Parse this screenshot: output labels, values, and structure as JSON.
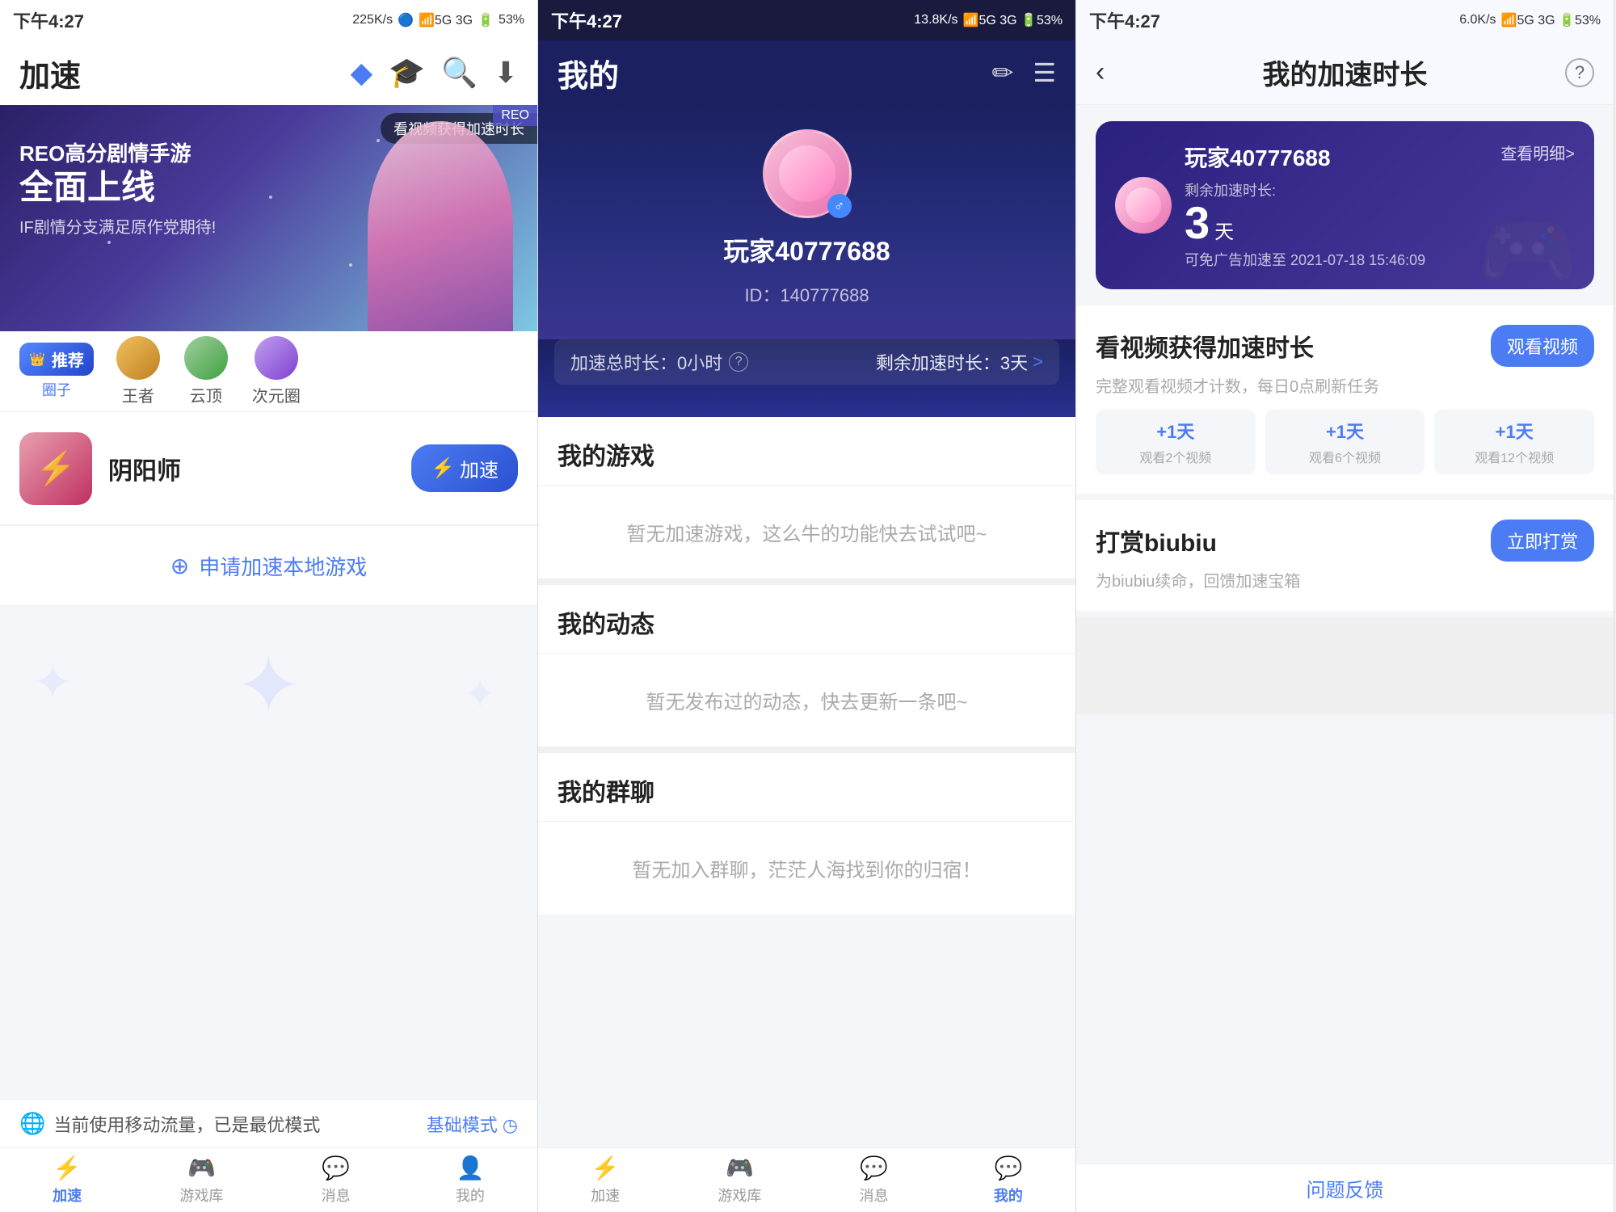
{
  "panel1": {
    "status": {
      "time": "下午4:27",
      "network_speed": "225K/s",
      "battery": "53%",
      "icons": "🔵 ♪ ◷ HD 📶 5G 3G 🔋"
    },
    "header": {
      "title": "加速",
      "icon_blue": "◆",
      "icon_hat": "🎓",
      "icon_search": "🔍",
      "icon_download": "⬇"
    },
    "banner": {
      "watch_badge": "看视频获得加速时长",
      "corner": "REO",
      "brand": "REO高分剧情手游",
      "main_title": "全面上线",
      "sub_title": "IF剧情分支满足原作党期待!"
    },
    "categories": [
      {
        "label": "推荐\n圈子",
        "type": "highlight"
      },
      {
        "label": "王者",
        "type": "normal"
      },
      {
        "label": "云顶",
        "type": "normal"
      },
      {
        "label": "次元圈",
        "type": "normal"
      }
    ],
    "game": {
      "name": "阴阳师",
      "speed_btn": "加速"
    },
    "apply_bar": "申请加速本地游戏",
    "data_mode": {
      "text": "当前使用移动流量，已是最优模式",
      "link": "基础模式 ◷"
    },
    "nav": [
      {
        "label": "加速",
        "active": true
      },
      {
        "label": "游戏库",
        "active": false
      },
      {
        "label": "消息",
        "active": false
      },
      {
        "label": "我的",
        "active": false
      }
    ]
  },
  "panel2": {
    "status": {
      "time": "下午4:27",
      "network_speed": "13.8K/s"
    },
    "header": {
      "title": "我的",
      "edit_icon": "✏",
      "menu_icon": "☰"
    },
    "profile": {
      "username": "玩家40777688",
      "id": "ID：140777688",
      "gender": "♂"
    },
    "speed_bar": {
      "total_label": "加速总时长：0小时",
      "tooltip": "?",
      "remain_label": "剩余加速时长：3天",
      "arrow": ">"
    },
    "my_games": {
      "title": "我的游戏",
      "empty": "暂无加速游戏，这么牛的功能快去试试吧~"
    },
    "my_moments": {
      "title": "我的动态",
      "empty": "暂无发布过的动态，快去更新一条吧~"
    },
    "my_groups": {
      "title": "我的群聊",
      "empty": "暂无加入群聊，茫茫人海找到你的归宿！"
    },
    "nav": [
      {
        "label": "加速",
        "active": false
      },
      {
        "label": "游戏库",
        "active": false
      },
      {
        "label": "消息",
        "active": false
      },
      {
        "label": "我的",
        "active": true
      }
    ]
  },
  "panel3": {
    "status": {
      "time": "下午4:27",
      "network_speed": "6.0K/s"
    },
    "header": {
      "back": "‹",
      "title": "我的加速时长",
      "help": "?"
    },
    "accel_card": {
      "username": "玩家40777688",
      "detail_link": "查看明细>",
      "remain_label": "剩余加速时长:",
      "days": "3",
      "unit": "天",
      "until": "可免广告加速至 2021-07-18 15:46:09"
    },
    "watch_video": {
      "title": "看视频获得加速时长",
      "subtitle": "完整观看视频才计数，每日0点刷新任务",
      "btn": "观看视频",
      "rewards": [
        {
          "plus": "+1天",
          "label": "观看2个视频"
        },
        {
          "plus": "+1天",
          "label": "观看6个视频"
        },
        {
          "plus": "+1天",
          "label": "观看12个视频"
        }
      ]
    },
    "biubiu": {
      "title": "打赏biubiu",
      "subtitle": "为biubiu续命，回馈加速宝箱",
      "btn": "立即打赏"
    },
    "feedback": "问题反馈"
  }
}
